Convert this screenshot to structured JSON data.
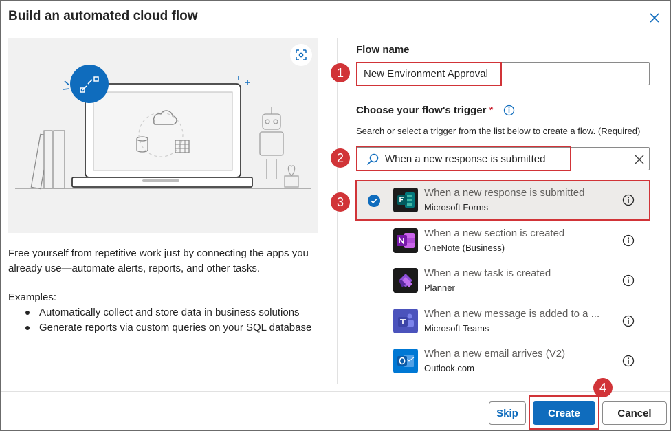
{
  "dialog": {
    "title": "Build an automated cloud flow"
  },
  "left": {
    "description": "Free yourself from repetitive work just by connecting the apps you already use—automate alerts, reports, and other tasks.",
    "examples_label": "Examples:",
    "examples": [
      "Automatically collect and store data in business solutions",
      "Generate reports via custom queries on your SQL database"
    ]
  },
  "form": {
    "flow_name_label": "Flow name",
    "flow_name_value": "New Environment Approval",
    "trigger_label": "Choose your flow's trigger",
    "required_mark": "*",
    "trigger_hint": "Search or select a trigger from the list below to create a flow. (Required)",
    "search_value": "When a new response is submitted"
  },
  "triggers": [
    {
      "name": "When a new response is submitted",
      "connector": "Microsoft Forms",
      "selected": true,
      "icon": "microsoft-forms-icon",
      "color": "#038387"
    },
    {
      "name": "When a new section is created",
      "connector": "OneNote (Business)",
      "selected": false,
      "icon": "onenote-icon",
      "color": "#7719aa"
    },
    {
      "name": "When a new task is created",
      "connector": "Planner",
      "selected": false,
      "icon": "planner-icon",
      "color": "#31752f"
    },
    {
      "name": "When a new message is added to a ...",
      "connector": "Microsoft Teams",
      "selected": false,
      "icon": "teams-icon",
      "color": "#4b53bc"
    },
    {
      "name": "When a new email arrives (V2)",
      "connector": "Outlook.com",
      "selected": false,
      "icon": "outlook-icon",
      "color": "#0078d4"
    }
  ],
  "buttons": {
    "skip": "Skip",
    "create": "Create",
    "cancel": "Cancel"
  },
  "annotations": [
    "1",
    "2",
    "3",
    "4"
  ],
  "colors": {
    "accent": "#0f6cbd",
    "highlight": "#d13438"
  }
}
